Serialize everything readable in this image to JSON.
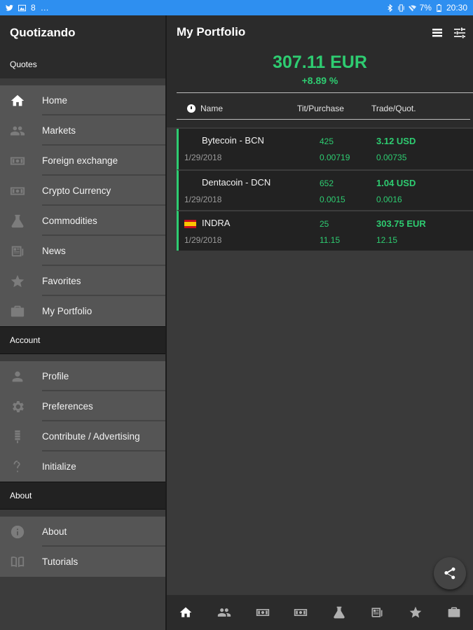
{
  "status_bar": {
    "left_text": "8",
    "battery": "7%",
    "time": "20:30"
  },
  "drawer": {
    "app_title": "Quotizando",
    "sections": {
      "quotes_title": "Quotes",
      "account_title": "Account",
      "about_title": "About"
    },
    "quotes_items": [
      {
        "label": "Home",
        "icon": "home-icon"
      },
      {
        "label": "Markets",
        "icon": "people-icon"
      },
      {
        "label": "Foreign exchange",
        "icon": "banknote-icon"
      },
      {
        "label": "Crypto Currency",
        "icon": "banknote-icon"
      },
      {
        "label": "Commodities",
        "icon": "flask-icon"
      },
      {
        "label": "News",
        "icon": "newspaper-icon"
      },
      {
        "label": "Favorites",
        "icon": "star-icon"
      },
      {
        "label": "My Portfolio",
        "icon": "briefcase-icon"
      }
    ],
    "account_items": [
      {
        "label": "Profile",
        "icon": "person-icon"
      },
      {
        "label": "Preferences",
        "icon": "gear-icon"
      },
      {
        "label": "Contribute / Advertising",
        "icon": "coin-stack-icon"
      },
      {
        "label": "Initialize",
        "icon": "question-icon"
      }
    ],
    "about_items": [
      {
        "label": "About",
        "icon": "info-icon"
      },
      {
        "label": "Tutorials",
        "icon": "book-icon"
      }
    ]
  },
  "portfolio": {
    "title": "My Portfolio",
    "total": "307.11 EUR",
    "change": "+8.89 %",
    "columns": {
      "name": "Name",
      "tit_purchase": "Tit/Purchase",
      "trade_quot": "Trade/Quot."
    },
    "rows": [
      {
        "name": "Bytecoin - BCN",
        "date": "1/29/2018",
        "qty": "425",
        "purchase": "0.00719",
        "trade": "3.12 USD",
        "quot": "0.00735",
        "flag": ""
      },
      {
        "name": "Dentacoin - DCN",
        "date": "1/29/2018",
        "qty": "652",
        "purchase": "0.0015",
        "trade": "1.04 USD",
        "quot": "0.0016",
        "flag": ""
      },
      {
        "name": "INDRA",
        "date": "1/29/2018",
        "qty": "25",
        "purchase": "11.15",
        "trade": "303.75 EUR",
        "quot": "12.15",
        "flag": "spain-flag"
      }
    ]
  },
  "colors": {
    "accent": "#2ecc71",
    "statusbar": "#2e8ff0"
  }
}
